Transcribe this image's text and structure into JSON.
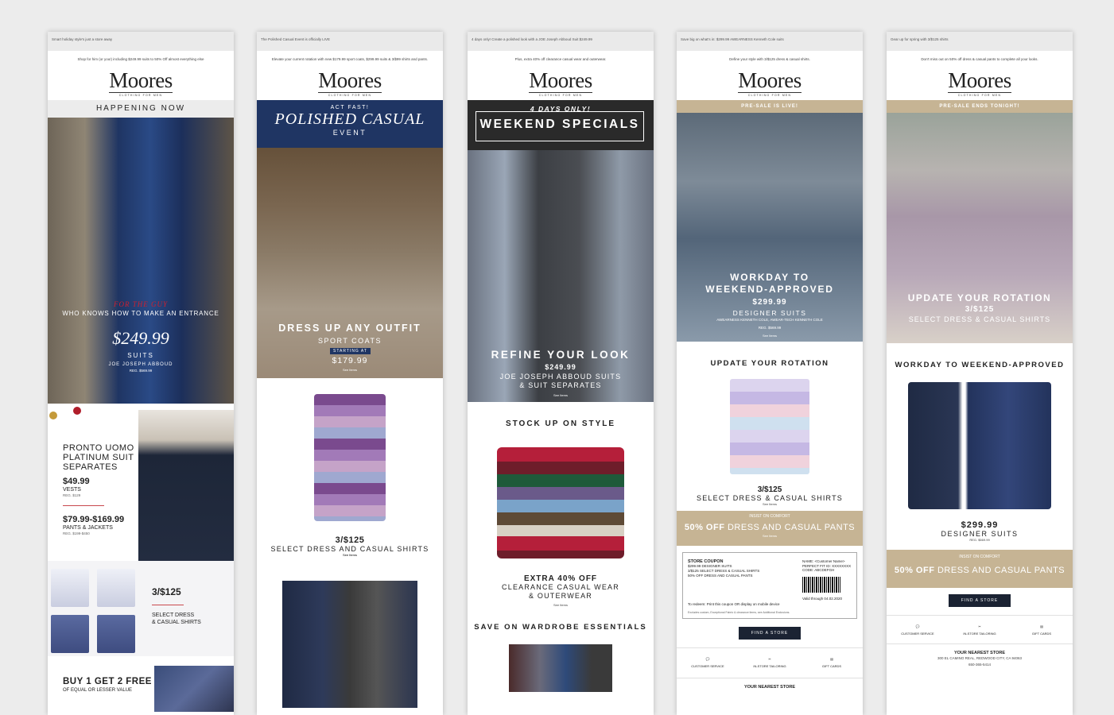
{
  "brand": {
    "name": "Moores",
    "tagline": "CLOTHING FOR MEN"
  },
  "emails": [
    {
      "preheader": "Smart holiday style's just a store away",
      "subline": "Shop for him (or you!) including $249.99 suits to 50% Off almost everything else",
      "band": "HAPPENING NOW",
      "hero": {
        "line1": "FOR THE GUY",
        "line2": "WHO KNOWS HOW TO MAKE AN ENTRANCE",
        "price": "$249.99",
        "product": "SUITS",
        "brand": "JOE JOSEPH ABBOUD",
        "reg": "REG. $569.99"
      },
      "pronto": {
        "title": "PRONTO UOMO\nPLATINUM SUIT\nSEPARATES",
        "price1": "$49.99",
        "label1": "VESTS",
        "reg1": "REG. $129",
        "price2": "$79.99-$169.99",
        "label2": "PANTS & JACKETS",
        "reg2": "REG. $199-$450"
      },
      "shirts": {
        "price": "3/$125",
        "label": "SELECT DRESS\n& CASUAL SHIRTS"
      },
      "bogo": {
        "title": "BUY 1 GET 2 FREE",
        "sub": "OF EQUAL OR LESSER VALUE"
      }
    },
    {
      "preheader": "The Polished Casual Event is officially LIVE",
      "subline": "Elevate your current rotation with new $179.99 sport coats, $299.99 suits & 3/$99 shirts and pants.",
      "banner": {
        "top": "ACT FAST!",
        "title": "POLISHED CASUAL",
        "event": "EVENT"
      },
      "hero": {
        "line1": "DRESS UP ANY OUTFIT",
        "line2": "SPORT COATS",
        "starting": "STARTING AT",
        "price": "$179.99",
        "cta": "See Items"
      },
      "shirts": {
        "price": "3/$125",
        "label": "SELECT DRESS AND CASUAL SHIRTS",
        "cta": "See Items"
      }
    },
    {
      "preheader": "4 days only! Create a polished look with a JOE Joseph Abboud Suit $249.99",
      "subline": "Plus, extra 40% off clearance casual wear and outerwear.",
      "banner": {
        "top": "4 DAYS ONLY!",
        "title": "WEEKEND SPECIALS"
      },
      "hero": {
        "line1": "REFINE YOUR LOOK",
        "price": "$249.99",
        "line2": "JOE JOSEPH ABBOUD SUITS\n& SUIT SEPARATES",
        "cta": "See Items"
      },
      "section1": "STOCK UP ON STYLE",
      "offer": {
        "title": "EXTRA 40% OFF",
        "sub": "CLEARANCE CASUAL WEAR\n& OUTERWEAR",
        "cta": "See Items"
      },
      "section2": "SAVE ON WARDROBE ESSENTIALS"
    },
    {
      "preheader": "Save big on what's in: $299.99 AWEARNESS Kenneth Cole suits",
      "subline": "Define your style with 3/$125 dress & casual shirts.",
      "tan": "PRE-SALE IS LIVE!",
      "hero": {
        "line1": "WORKDAY TO\nWEEKEND-APPROVED",
        "price": "$299.99",
        "product": "DESIGNER SUITS",
        "brand": "AWEARNESS KENNETH COLE, AWEAR-TECH KENNETH COLE",
        "reg": "REG. $569.99",
        "cta": "See Items"
      },
      "section": "UPDATE YOUR ROTATION",
      "shirts": {
        "price": "3/$125",
        "label": "SELECT DRESS & CASUAL SHIRTS",
        "cta": "See Items"
      },
      "comfort": {
        "top": "INSIST ON COMFORT",
        "bold": "50% OFF",
        "rest": " DRESS AND CASUAL PANTS",
        "cta": "See Items"
      },
      "coupon": {
        "title": "STORE COUPON",
        "l1": "$299.99 DESIGNER SUITS",
        "l2": "3/$125 SELECT DRESS & CASUAL SHIRTS",
        "l3": "50% OFF DRESS AND CASUAL PANTS",
        "name": "NAME: <Customer Name>",
        "fit": "PERFECT FIT ID: XXXXXXXX",
        "code": "CODE: ABCDEFGH",
        "valid": "Valid through 04.02.2020",
        "redeem": "To redeem: Print this coupon OR display on mobile device",
        "fine": "Excludes custom, Exceptional Fabric & clearance items, see Additional Exclusions."
      },
      "find": "FIND A STORE",
      "icons": [
        {
          "icon": "customer-service-icon",
          "label": "CUSTOMER SERVICE",
          "glyph": "💬"
        },
        {
          "icon": "tailoring-icon",
          "label": "IN-STORE TAILORING",
          "glyph": "✂"
        },
        {
          "icon": "gift-card-icon",
          "label": "GIFT CARDS",
          "glyph": "▤"
        }
      ],
      "nearest": "YOUR NEAREST STORE"
    },
    {
      "preheader": "Gear up for spring with 3/$125 shirts",
      "subline": "Don't miss out on 50% off dress & casual pants to complete all your looks.",
      "tan": "PRE-SALE ENDS TONIGHT!",
      "hero": {
        "line1": "UPDATE YOUR ROTATION",
        "price": "3/$125",
        "label": "SELECT DRESS & CASUAL SHIRTS"
      },
      "section": "WORKDAY TO WEEKEND-APPROVED",
      "suits": {
        "price": "$299.99",
        "label": "DESIGNER SUITS",
        "reg": "REG. $569.99"
      },
      "comfort": {
        "top": "INSIST ON COMFORT",
        "bold": "50% OFF",
        "rest": " DRESS AND CASUAL PANTS"
      },
      "find": "FIND A STORE",
      "icons": [
        {
          "icon": "customer-service-icon",
          "label": "CUSTOMER SERVICE",
          "glyph": "💬"
        },
        {
          "icon": "tailoring-icon",
          "label": "IN-STORE TAILORING",
          "glyph": "✂"
        },
        {
          "icon": "gift-card-icon",
          "label": "GIFT CARDS",
          "glyph": "▤"
        }
      ],
      "nearest": "YOUR NEAREST STORE",
      "addr1": "300 EL CAMINO REAL, REDWOOD CITY, CA 94063",
      "addr2": "650-365-5414"
    }
  ]
}
